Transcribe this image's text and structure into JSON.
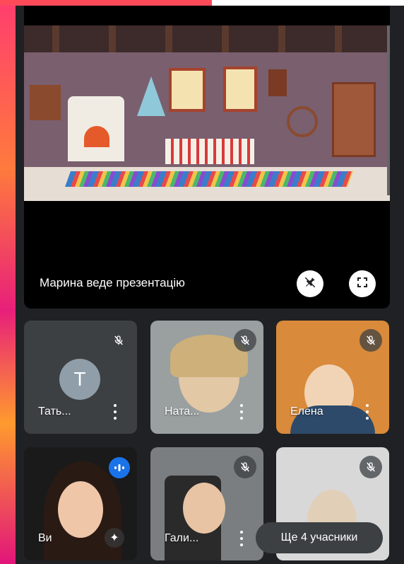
{
  "presentation": {
    "label": "Марина веде презентацію",
    "unpin_icon": "pin-off-icon",
    "fullscreen_icon": "fullscreen-icon"
  },
  "participants": [
    {
      "name": "Тать...",
      "avatar_letter": "T",
      "muted": true
    },
    {
      "name": "Ната...",
      "muted": true
    },
    {
      "name": "Елена",
      "muted": true
    },
    {
      "name": "Ви",
      "speaking": true,
      "effects_icon": "sparkle-icon"
    },
    {
      "name": "Гали...",
      "muted": true
    },
    {
      "name": "",
      "muted": true
    }
  ],
  "more_participants": "Ще 4 учасники",
  "colors": {
    "background": "#202124",
    "tile": "#3c4043",
    "speaking_accent": "#1a73e8"
  }
}
